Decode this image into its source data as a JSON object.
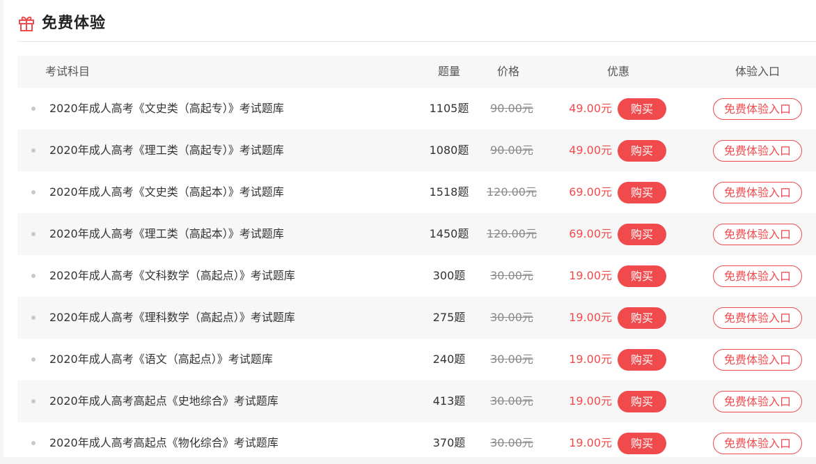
{
  "section": {
    "title": "免费体验",
    "icon": "gift-icon",
    "accent_color": "#f04a4d"
  },
  "table": {
    "headers": {
      "subject": "考试科目",
      "count": "题量",
      "price": "价格",
      "discount": "优惠",
      "entry": "体验入口"
    },
    "buy_label": "购买",
    "trial_label": "免费体验入口",
    "rows": [
      {
        "subject": "2020年成人高考《文史类（高起专）》考试题库",
        "count": "1105题",
        "price": "90.00元",
        "discount": "49.00元"
      },
      {
        "subject": "2020年成人高考《理工类（高起专）》考试题库",
        "count": "1080题",
        "price": "90.00元",
        "discount": "49.00元"
      },
      {
        "subject": "2020年成人高考《文史类（高起本）》考试题库",
        "count": "1518题",
        "price": "120.00元",
        "discount": "69.00元"
      },
      {
        "subject": "2020年成人高考《理工类（高起本）》考试题库",
        "count": "1450题",
        "price": "120.00元",
        "discount": "69.00元"
      },
      {
        "subject": "2020年成人高考《文科数学（高起点）》考试题库",
        "count": "300题",
        "price": "30.00元",
        "discount": "19.00元"
      },
      {
        "subject": "2020年成人高考《理科数学（高起点）》考试题库",
        "count": "275题",
        "price": "30.00元",
        "discount": "19.00元"
      },
      {
        "subject": "2020年成人高考《语文（高起点）》考试题库",
        "count": "240题",
        "price": "30.00元",
        "discount": "19.00元"
      },
      {
        "subject": "2020年成人高考高起点《史地综合》考试题库",
        "count": "413题",
        "price": "30.00元",
        "discount": "19.00元"
      },
      {
        "subject": "2020年成人高考高起点《物化综合》考试题库",
        "count": "370题",
        "price": "30.00元",
        "discount": "19.00元"
      }
    ]
  }
}
